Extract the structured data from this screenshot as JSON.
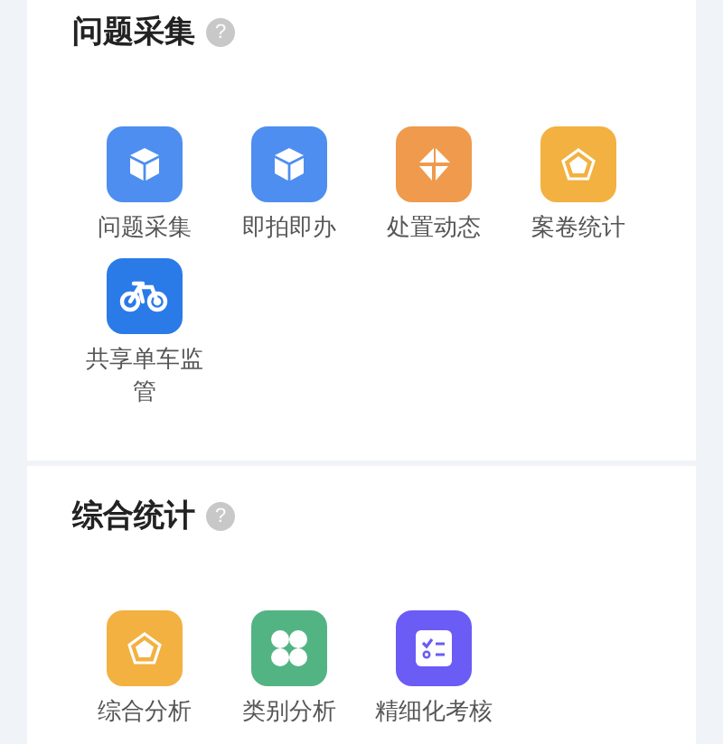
{
  "sections": [
    {
      "title": "问题采集",
      "help": "?",
      "items": [
        {
          "label": "问题采集",
          "kind": "cube",
          "color": "#4d8ef0"
        },
        {
          "label": "即拍即办",
          "kind": "cube",
          "color": "#4d8ef0"
        },
        {
          "label": "处置动态",
          "kind": "diamond",
          "color": "#ef9a4d"
        },
        {
          "label": "案卷统计",
          "kind": "pentagon",
          "color": "#f2b140"
        },
        {
          "label": "共享单车监管",
          "kind": "bike",
          "color": "#2a7ae8"
        }
      ]
    },
    {
      "title": "综合统计",
      "help": "?",
      "items": [
        {
          "label": "综合分析",
          "kind": "pentagon",
          "color": "#f2b140"
        },
        {
          "label": "类别分析",
          "kind": "clover",
          "color": "#53b483"
        },
        {
          "label": "精细化考核",
          "kind": "checklist",
          "color": "#6a5cf5"
        }
      ]
    }
  ]
}
